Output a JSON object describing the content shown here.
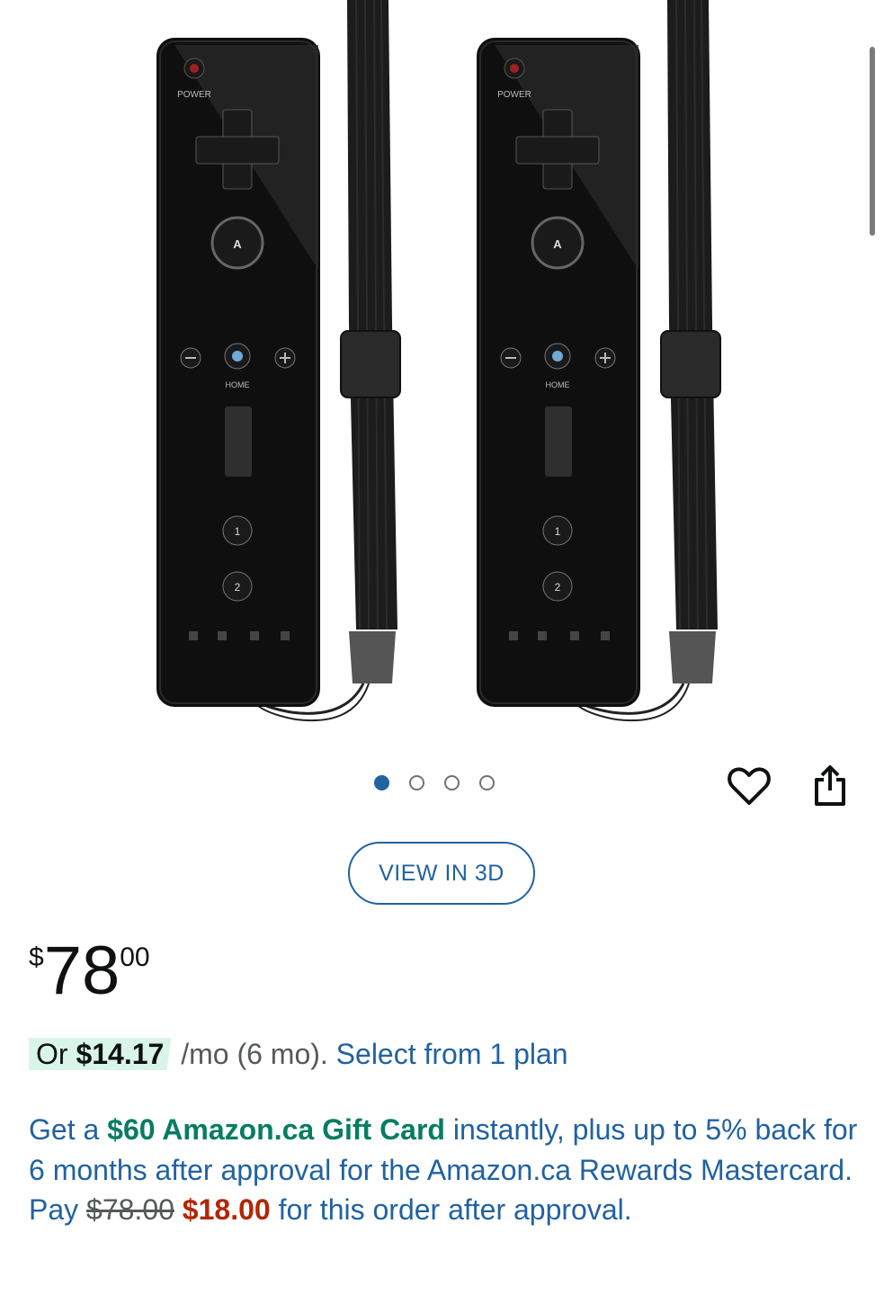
{
  "gallery": {
    "image_alt": "Two black remote controllers with wrist straps",
    "controller": {
      "power_label": "POWER",
      "a_label": "A",
      "home_label": "HOME",
      "one_label": "1",
      "two_label": "2"
    },
    "dots": {
      "count": 4,
      "active_index": 0
    }
  },
  "actions": {
    "wishlist_icon": "heart-icon",
    "share_icon": "share-icon"
  },
  "view_3d": {
    "label": "VIEW IN 3D"
  },
  "price": {
    "symbol": "$",
    "whole": "78",
    "fraction": "00"
  },
  "plan": {
    "prefix": "Or ",
    "amount": "$14.17",
    "suffix": " /mo (6 mo). ",
    "link": "Select from 1 plan"
  },
  "promo": {
    "text1": "Get a ",
    "highlight": "$60 Amazon.ca Gift Card",
    "text2": " instantly, plus up to 5% back for 6 months after approval for the Amazon.ca Rewards Mastercard.",
    "pay_label": "Pay ",
    "old_price": "$78.00",
    "new_price": "$18.00",
    "pay_suffix": " for this order after approval."
  },
  "colors": {
    "link": "#2162a1",
    "green": "#067d62",
    "red": "#b12704",
    "highlight_bg": "#d9f5ea"
  }
}
